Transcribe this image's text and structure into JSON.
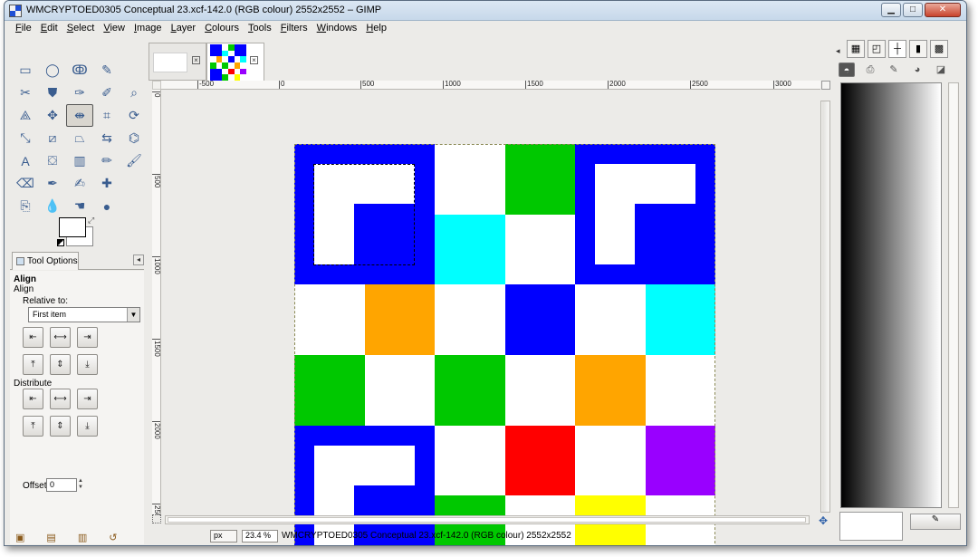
{
  "window": {
    "title": "WMCRYPTOED0305 Conceptual 23.xcf-142.0 (RGB colour) 2552x2552 – GIMP",
    "minimize": "▁",
    "maximize": "□",
    "close": "✕"
  },
  "menu": [
    {
      "u": "F",
      "rest": "ile"
    },
    {
      "u": "E",
      "rest": "dit"
    },
    {
      "u": "S",
      "rest": "elect"
    },
    {
      "u": "V",
      "rest": "iew"
    },
    {
      "u": "I",
      "rest": "mage"
    },
    {
      "u": "L",
      "rest": "ayer"
    },
    {
      "u": "C",
      "rest": "olours"
    },
    {
      "u": "T",
      "rest": "ools"
    },
    {
      "u": "F",
      "rest": "ilters"
    },
    {
      "u": "W",
      "rest": "indows"
    },
    {
      "u": "H",
      "rest": "elp"
    }
  ],
  "tools": [
    {
      "name": "rect-select-icon",
      "glyph": "▭"
    },
    {
      "name": "ellipse-select-icon",
      "glyph": "◯"
    },
    {
      "name": "free-select-icon",
      "glyph": "ↂ"
    },
    {
      "name": "fuzzy-select-icon",
      "glyph": "✎"
    },
    {
      "name": "none-1",
      "glyph": ""
    },
    {
      "name": "scissors-icon",
      "glyph": "✂"
    },
    {
      "name": "foreground-select-icon",
      "glyph": "⛊"
    },
    {
      "name": "paths-icon",
      "glyph": "✑"
    },
    {
      "name": "color-picker-icon",
      "glyph": "✐"
    },
    {
      "name": "zoom-icon",
      "glyph": "⌕"
    },
    {
      "name": "measure-icon",
      "glyph": "⟁"
    },
    {
      "name": "move-icon",
      "glyph": "✥"
    },
    {
      "name": "align-icon",
      "glyph": "⇼",
      "active": true
    },
    {
      "name": "crop-icon",
      "glyph": "⌗"
    },
    {
      "name": "rotate-icon",
      "glyph": "⟳"
    },
    {
      "name": "scale-icon",
      "glyph": "⤡"
    },
    {
      "name": "shear-icon",
      "glyph": "⧄"
    },
    {
      "name": "perspective-icon",
      "glyph": "⏢"
    },
    {
      "name": "flip-icon",
      "glyph": "⇆"
    },
    {
      "name": "cage-icon",
      "glyph": "⌬"
    },
    {
      "name": "text-icon",
      "glyph": "A"
    },
    {
      "name": "bucket-fill-icon",
      "glyph": "⛋"
    },
    {
      "name": "blend-icon",
      "glyph": "▥"
    },
    {
      "name": "pencil-icon",
      "glyph": "✏"
    },
    {
      "name": "paintbrush-icon",
      "glyph": "🖌"
    },
    {
      "name": "eraser-icon",
      "glyph": "⌫"
    },
    {
      "name": "airbrush-icon",
      "glyph": "✒"
    },
    {
      "name": "ink-icon",
      "glyph": "✍"
    },
    {
      "name": "heal-icon",
      "glyph": "✚"
    },
    {
      "name": "none-2",
      "glyph": ""
    },
    {
      "name": "clone-icon",
      "glyph": "⎘"
    },
    {
      "name": "blur-icon",
      "glyph": "💧"
    },
    {
      "name": "smudge-icon",
      "glyph": "☚"
    },
    {
      "name": "dodge-burn-icon",
      "glyph": "●"
    },
    {
      "name": "none-3",
      "glyph": ""
    }
  ],
  "tool_options": {
    "tab_label": "Tool Options",
    "heading": "Align",
    "subheading": "Align",
    "relative_to_label": "Relative to:",
    "relative_to_value": "First item",
    "distribute_label": "Distribute",
    "offset_label": "Offset:",
    "offset_value": "0"
  },
  "align_buttons": [
    "⇤",
    "⟷",
    "⇥",
    "⤒",
    "⇕",
    "⤓"
  ],
  "image_tabs": {
    "close1": "×",
    "close2": "×"
  },
  "ruler": {
    "h_labels": [
      "-500",
      "0",
      "500",
      "1000",
      "1500",
      "2000",
      "2500",
      "3000"
    ],
    "v_labels": [
      "0",
      "500",
      "1000",
      "1500",
      "2000",
      "2500"
    ]
  },
  "board": [
    [
      "",
      "",
      "#ffffff",
      "#00c800",
      "",
      ""
    ],
    [
      "",
      "",
      "#00ffff",
      "#ffffff",
      "",
      ""
    ],
    [
      "#ffffff",
      "#ffa500",
      "#ffffff",
      "#0000ff",
      "#ffffff",
      "#00ffff"
    ],
    [
      "#00c800",
      "#ffffff",
      "#00c800",
      "#ffffff",
      "#ffa500",
      "#ffffff"
    ],
    [
      "",
      "",
      "#ffffff",
      "#ff0000",
      "#ffffff",
      "#9900ff"
    ],
    [
      "",
      "",
      "#00c800",
      "#ffffff",
      "#ffff00",
      "#ffffff"
    ]
  ],
  "colors": {
    "finder_blue": "#0000ff",
    "window_bg": "#ecebe8"
  },
  "status": {
    "unit": "px",
    "zoom": "23.4 %",
    "text": "WMCRYPTOED0305 Conceptual 23.xcf-142.0 (RGB colour) 2552x2552"
  },
  "dock": {
    "edit_label": "✎"
  }
}
